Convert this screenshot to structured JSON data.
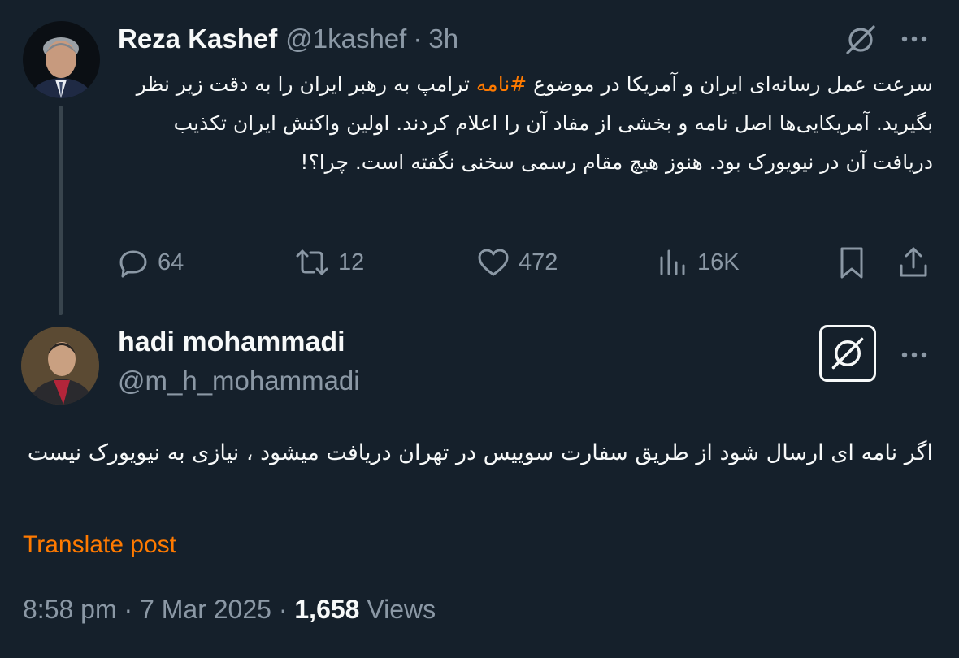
{
  "colors": {
    "background": "#15202b",
    "text_primary": "#f7f9f9",
    "text_secondary": "#8b98a5",
    "accent": "#ff7a00",
    "thread_line": "#38444d"
  },
  "parent_tweet": {
    "author_name": "Reza Kashef",
    "author_handle": "@1kashef",
    "separator": "·",
    "time": "3h",
    "text_before_hashtag": "سرعت عمل رسانه‌ای ایران و آمریکا در موضوع ",
    "hashtag": "#نامه",
    "text_after_hashtag": " ترامپ به رهبر ایران را به دقت زیر نظر بگیرید. آمریکایی‌ها اصل نامه و بخشی از مفاد آن را اعلام کردند. اولین واکنش ایران تکذیب دریافت آن در نیویورک بود. هنوز هیچ مقام رسمی سخنی نگفته است. چرا؟!",
    "icons": {
      "grok": "grok-icon",
      "more": "more-horizontal-icon",
      "reply": "reply-icon",
      "retweet": "retweet-icon",
      "like": "heart-icon",
      "views": "views-icon",
      "bookmark": "bookmark-icon",
      "share": "share-icon"
    },
    "stats": {
      "replies": "64",
      "retweets": "12",
      "likes": "472",
      "views": "16K"
    }
  },
  "focused_tweet": {
    "author_name": "hadi mohammadi",
    "author_handle": "@m_h_mohammadi",
    "text": "اگر نامه ای ارسال شود از طریق سفارت سوییس در تهران دریافت میشود ، نیازی به نیویورک نیست",
    "translate_label": "Translate post",
    "time": "8:58 pm",
    "separator": "·",
    "date": "7 Mar 2025",
    "views_count": "1,658",
    "views_label": "Views"
  }
}
